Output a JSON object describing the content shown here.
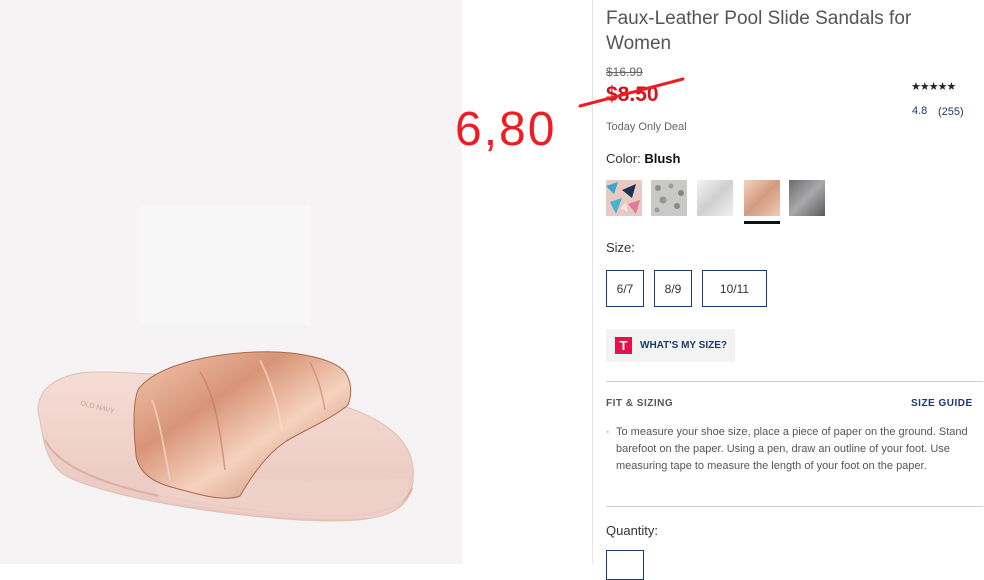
{
  "product": {
    "title": "Faux-Leather Pool Slide Sandals for Women",
    "original_price": "$16.99",
    "sale_price": "$8.50",
    "deal_text": "Today Only Deal",
    "stars": "★★★★★",
    "rating": "4.8",
    "review_count": "(255)"
  },
  "annotation": {
    "price": "6,80",
    "color": "#ee1d24"
  },
  "color_selector": {
    "label": "Color:",
    "selected": "Blush",
    "swatches": [
      "pink-blue-print",
      "grey-leopard",
      "silver",
      "blush",
      "gunmetal"
    ]
  },
  "size_selector": {
    "label": "Size:",
    "options": [
      "6/7",
      "8/9",
      "10/11"
    ]
  },
  "size_helper": {
    "icon_letter": "T",
    "label": "WHAT'S MY SIZE?"
  },
  "fit": {
    "title": "FIT & SIZING",
    "size_guide": "SIZE GUIDE",
    "bullet": "·",
    "text": "To measure your shoe size, place a piece of paper on the ground. Stand barefoot on the paper. Using a pen, draw an outline of your foot. Use measuring tape to measure the length of your foot on the paper."
  },
  "quantity": {
    "label": "Quantity:"
  },
  "colors": {
    "brand_navy": "#1c3a68",
    "sale_red": "#d0141c",
    "accent_pink": "#e2124a"
  }
}
